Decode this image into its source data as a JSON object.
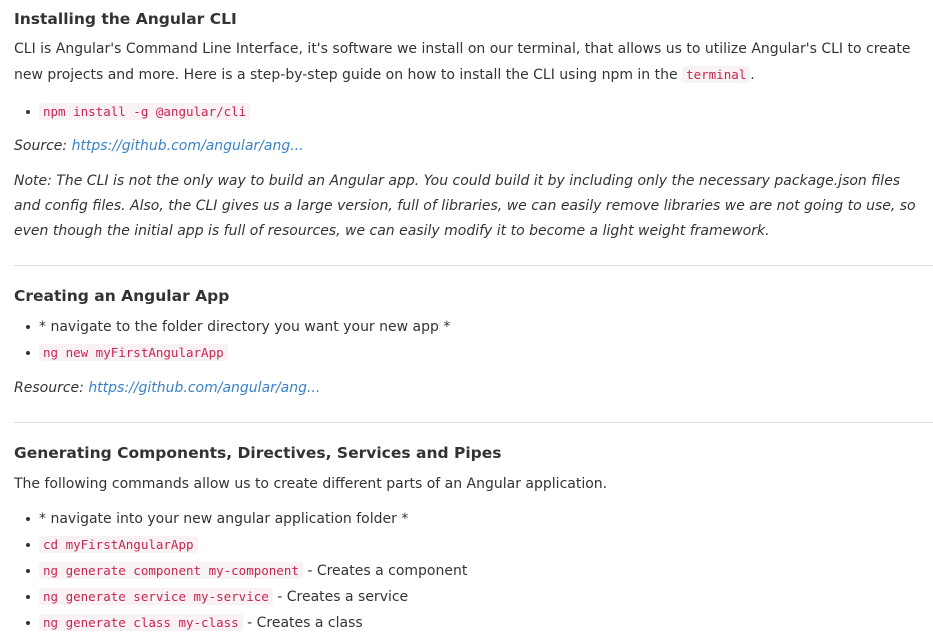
{
  "section1": {
    "title": "Installing the Angular CLI",
    "intro_text": "CLI is Angular's Command Line Interface, it's software we install on our terminal, that allows us to utilize Angular's CLI to create new projects and more. Here is a step-by-step guide on how to install the CLI using npm in the ",
    "intro_code": "terminal",
    "intro_end": ".",
    "list": [
      "npm install -g @angular/cli"
    ],
    "source_label": "Source: ",
    "source_link": "https://github.com/angular/ang...",
    "note": "Note: The CLI is not the only way to build an Angular app. You could build it by including only the necessary package.json files and config files. Also, the CLI gives us a large version, full of libraries, we can easily remove libraries we are not going to use, so even though the initial app is full of resources, we can easily modify it to become a light weight framework."
  },
  "section2": {
    "title": "Creating an Angular App",
    "item1_text": "* navigate to the folder directory you want your new app *",
    "item2_code": "ng new myFirstAngularApp",
    "resource_label": "Resource: ",
    "resource_link": "https://github.com/angular/ang..."
  },
  "section3": {
    "title": "Generating Components, Directives, Services and Pipes",
    "intro": "The following commands allow us to create different parts of an Angular application.",
    "item1_text": "* navigate into your new angular application folder *",
    "item2_code": "cd myFirstAngularApp",
    "item3_code": "ng generate component my-component",
    "item3_text": " - Creates a component",
    "item4_code": "ng generate service my-service",
    "item4_text": " - Creates a service",
    "item5_code": "ng generate class my-class",
    "item5_text": " - Creates a class"
  },
  "colors": {
    "code_text": "#c7254e",
    "code_bg": "#f9f2f4",
    "link": "#3a82c4"
  }
}
